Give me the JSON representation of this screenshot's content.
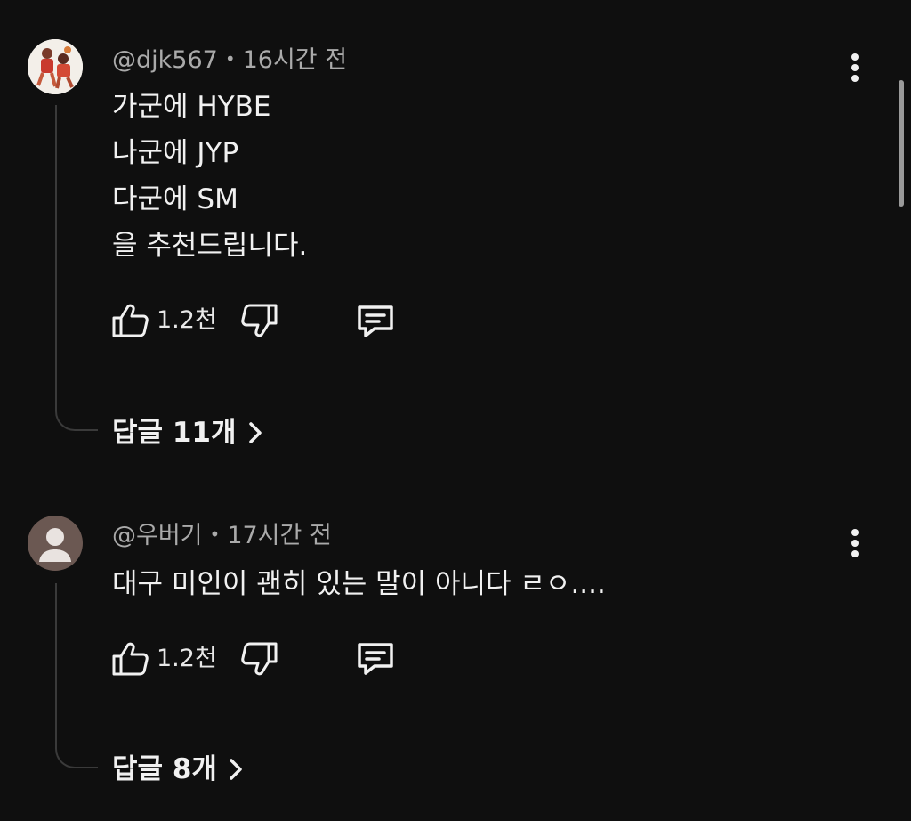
{
  "comments": [
    {
      "handle": "@djk567",
      "separator": "•",
      "time": "16시간 전",
      "lines": [
        "가군에 HYBE",
        "나군에 JYP",
        "다군에 SM",
        "을 추천드립니다."
      ],
      "likes": "1.2천",
      "replies": "답글 11개",
      "avatar": "photo-avatar"
    },
    {
      "handle": "@우버기",
      "separator": "•",
      "time": "17시간 전",
      "lines": [
        "대구 미인이 괜히 있는 말이 아니다 ㄹㅇ...."
      ],
      "likes": "1.2천",
      "replies": "답글 8개",
      "avatar": "default-avatar"
    }
  ],
  "colors": {
    "background": "#0f0f0f",
    "text": "#f1f1f1",
    "meta": "#aaaaaa",
    "thread_line": "#3a3a3a",
    "default_avatar_bg": "#6b5852"
  }
}
